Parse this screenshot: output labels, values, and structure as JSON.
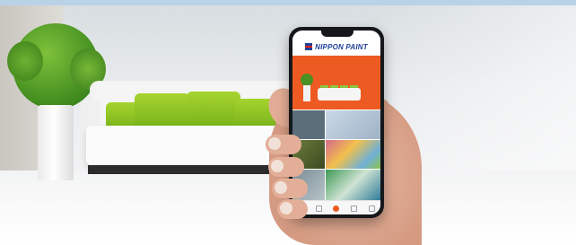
{
  "scene": {
    "description_colors": {
      "wall": "#e8ebed",
      "floor": "#f6f7f8",
      "cushion_green": "#8cc63f",
      "plant_green": "#4c8f22"
    }
  },
  "phone": {
    "app": {
      "brand_name": "NIPPON PAINT",
      "brand_colors": {
        "blue": "#1f3f9a",
        "red": "#e2211c",
        "accent_orange": "#ee5b22"
      },
      "hero_background": "#ee5b22",
      "tiles": [
        {
          "name": "tile-1",
          "color": "#5b6e7a"
        },
        {
          "name": "tile-2",
          "color": "#c9d8e6"
        },
        {
          "name": "tile-3",
          "color": "#6b7b3a"
        },
        {
          "name": "tile-4",
          "color": "#d56a8c"
        },
        {
          "name": "tile-5",
          "color": "#7a8c95"
        },
        {
          "name": "tile-6",
          "color": "#3f9a55"
        }
      ],
      "tab_icons": [
        "home-icon",
        "grid-icon",
        "camera-icon",
        "store-icon",
        "more-icon"
      ],
      "active_tab": 2
    }
  }
}
